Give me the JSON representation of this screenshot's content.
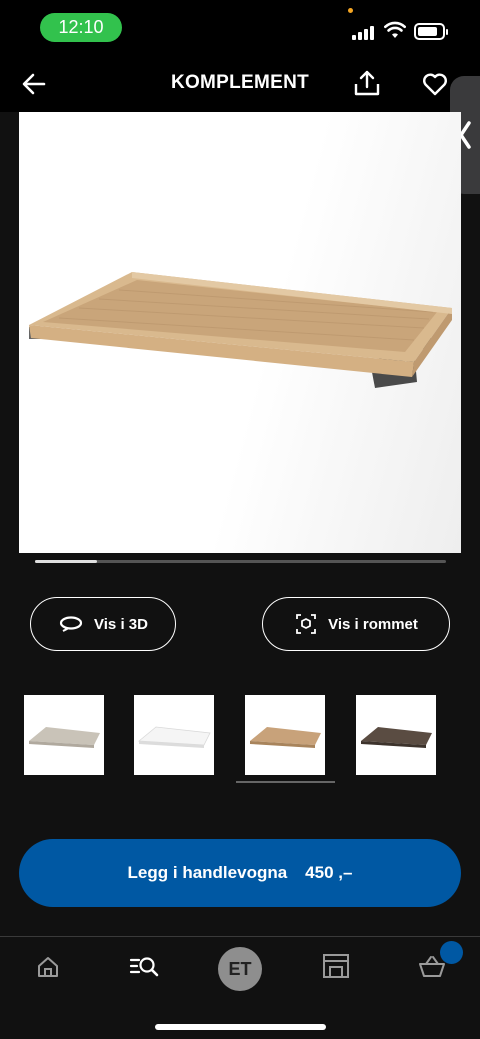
{
  "status_bar": {
    "time": "12:10"
  },
  "header": {
    "title": "KOMPLEMENT"
  },
  "gallery": {
    "progress_fraction": 0.15
  },
  "actions": {
    "view_3d_label": "Vis i 3D",
    "view_room_label": "Vis i rommet"
  },
  "variants": [
    {
      "name": "thumbnail-variant-beige",
      "color": "#c9c3b8"
    },
    {
      "name": "thumbnail-variant-white",
      "color": "#f2f2f2"
    },
    {
      "name": "thumbnail-variant-oak",
      "color": "#c8a27a"
    },
    {
      "name": "thumbnail-variant-dark",
      "color": "#5a4c42"
    }
  ],
  "cart": {
    "label": "Legg i handlevogna",
    "price": "450 ,–"
  },
  "bottom_nav": {
    "avatar_initials": "ET"
  },
  "colors": {
    "accent": "#0058a3",
    "time_pill": "#32c24d",
    "background": "#111111"
  }
}
